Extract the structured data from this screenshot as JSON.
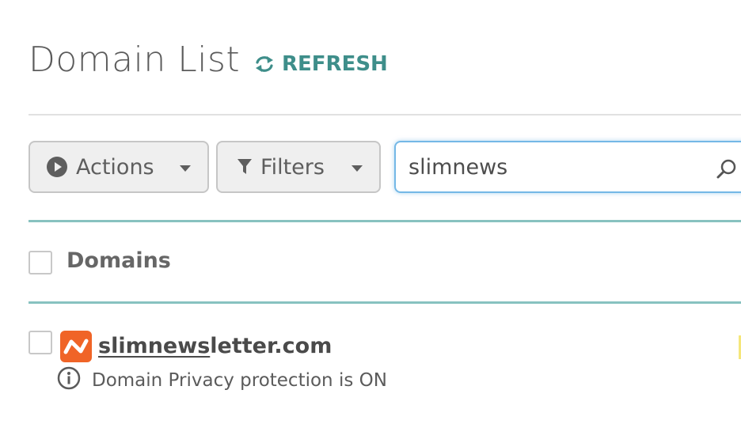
{
  "header": {
    "title": "Domain List",
    "refresh_label": "REFRESH"
  },
  "toolbar": {
    "actions_label": "Actions",
    "filters_label": "Filters",
    "search_value": "slimnews"
  },
  "table": {
    "column_header": "Domains",
    "rows": [
      {
        "domain_prefix": "slimnews",
        "domain_suffix": "letter.com",
        "privacy_note": "Domain Privacy protection is ON"
      }
    ]
  },
  "colors": {
    "accent_teal": "#3e8e8a",
    "divider_teal": "#88c2c0",
    "brand_orange": "#f06427",
    "search_focus": "#74b8e6"
  },
  "icons": {
    "refresh": "refresh-icon",
    "actions": "play-circle-icon",
    "filters": "funnel-icon",
    "search": "search-icon",
    "logo": "namecheap-logo-icon",
    "info": "info-icon"
  }
}
